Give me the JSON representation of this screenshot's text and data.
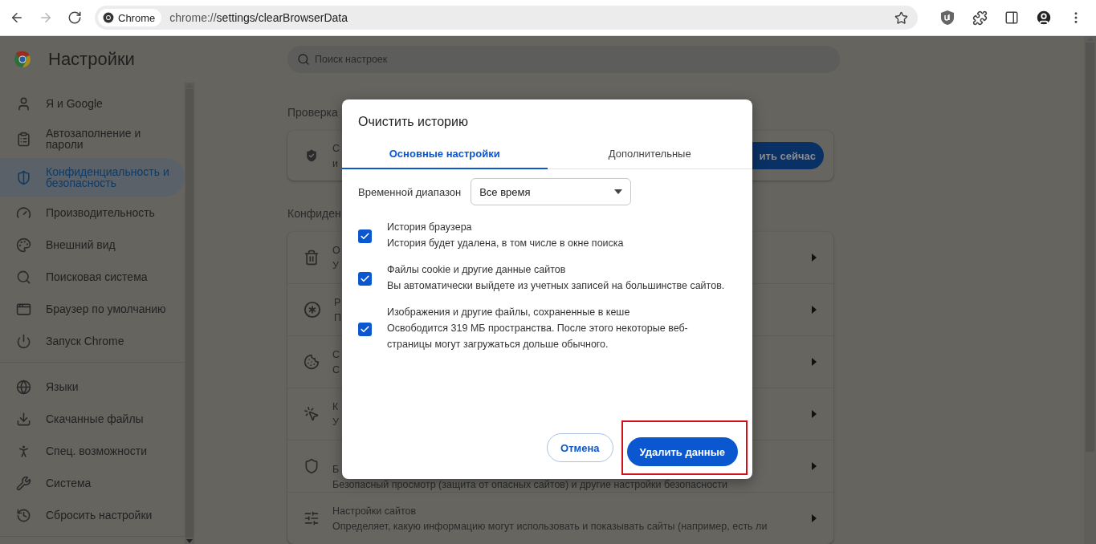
{
  "browser": {
    "nav": [
      {
        "kind": "back",
        "disabled": false
      },
      {
        "kind": "forward",
        "disabled": true
      },
      {
        "kind": "reload",
        "disabled": false
      }
    ],
    "chip": "Chrome",
    "url_scheme": "chrome://",
    "url_path": "settings/clearBrowserData"
  },
  "settings": {
    "title": "Настройки",
    "search_placeholder": "Поиск настроек",
    "sidebar": {
      "groups": [
        [
          {
            "label": "Я и Google",
            "selected": false
          },
          {
            "label": "Автозаполнение и пароли",
            "selected": false
          },
          {
            "label": "Конфиденциальность и безопасность",
            "selected": true
          },
          {
            "label": "Производительность",
            "selected": false
          },
          {
            "label": "Внешний вид",
            "selected": false
          },
          {
            "label": "Поисковая система",
            "selected": false
          },
          {
            "label": "Браузер по умолчанию",
            "selected": false
          },
          {
            "label": "Запуск Chrome",
            "selected": false
          }
        ],
        [
          {
            "label": "Языки",
            "selected": false
          },
          {
            "label": "Скачанные файлы",
            "selected": false
          },
          {
            "label": "Спец. возможности",
            "selected": false
          },
          {
            "label": "Система",
            "selected": false
          },
          {
            "label": "Сбросить настройки",
            "selected": false
          }
        ]
      ]
    },
    "safety_check": {
      "heading": "Проверка",
      "line_1": "С",
      "line_2": "и",
      "button": "ить сейчас"
    },
    "privacy": {
      "heading": "Конфиден",
      "rows": [
        {
          "title": "О",
          "subtitle": "У"
        },
        {
          "title": "Р",
          "subtitle": "П"
        },
        {
          "title": "С",
          "subtitle": "С"
        },
        {
          "title": "К",
          "subtitle": "У"
        },
        {
          "title": "Б",
          "subtitle": "Безопасный просмотр (защита от опасных сайтов) и другие настройки безопасности"
        },
        {
          "title": "Настройки сайтов",
          "subtitle": "Определяет, какую информацию могут использовать и показывать сайты (например, есть ли"
        }
      ]
    }
  },
  "dialog": {
    "title": "Очистить историю",
    "tabs": [
      {
        "label": "Основные настройки",
        "selected": true
      },
      {
        "label": "Дополнительные",
        "selected": false
      }
    ],
    "time_range": {
      "label": "Временной диапазон",
      "value": "Все время"
    },
    "options": [
      {
        "title": "История браузера",
        "description": "История будет удалена, в том числе в окне поиска",
        "checked": true
      },
      {
        "title": "Файлы cookie и другие данные сайтов",
        "description": "Вы автоматически выйдете из учетных записей на большинстве сайтов.",
        "checked": true
      },
      {
        "title": "Изображения и другие файлы, сохраненные в кеше",
        "description": "Освободится 319 МБ пространства. После этого некоторые веб-страницы могут загружаться дольше обычного.",
        "checked": true
      }
    ],
    "buttons": [
      {
        "kind": "secondary",
        "label": "Отмена",
        "highlighted": false
      },
      {
        "kind": "primary",
        "label": "Удалить данные",
        "highlighted": true
      }
    ]
  }
}
